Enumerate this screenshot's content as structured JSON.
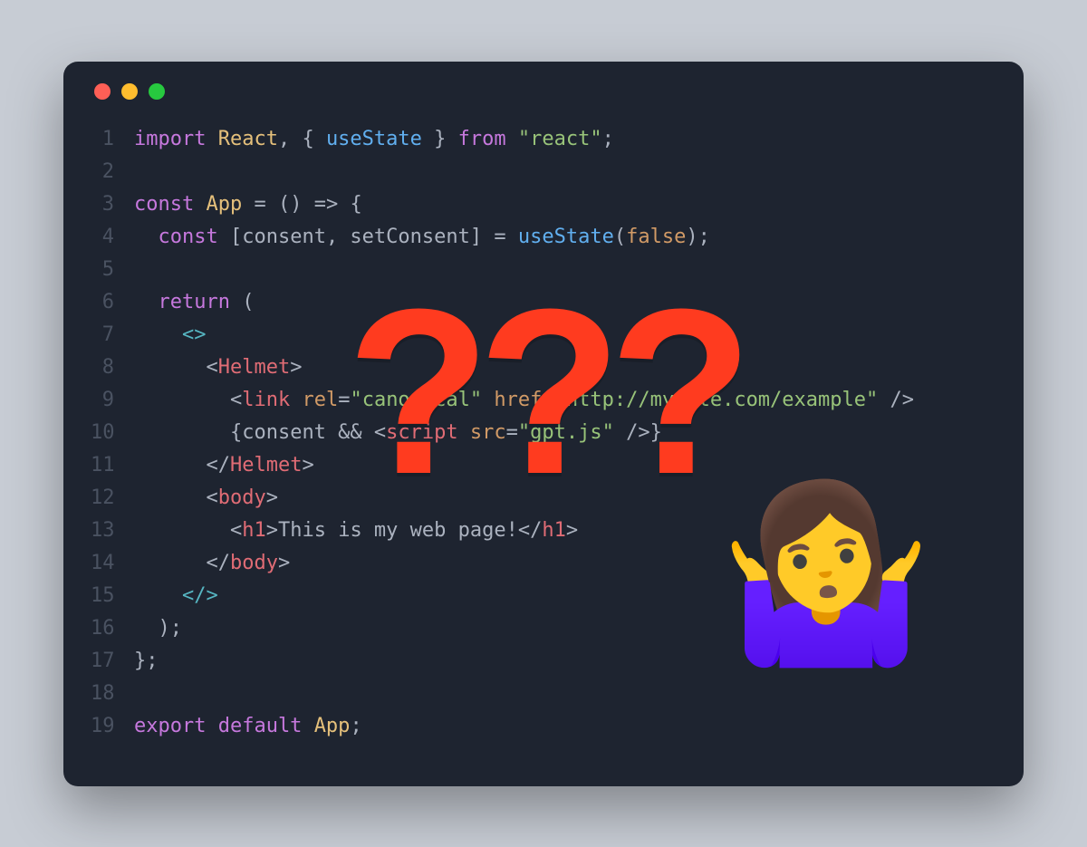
{
  "window": {
    "controls": [
      "close",
      "minimize",
      "zoom"
    ]
  },
  "overlay": {
    "question_marks": "???",
    "shrug_emoji": "🤷‍♀️"
  },
  "code": {
    "lines": [
      {
        "n": "1",
        "tokens": [
          {
            "t": "import ",
            "c": "kw"
          },
          {
            "t": "React",
            "c": "var"
          },
          {
            "t": ", { ",
            "c": "punc"
          },
          {
            "t": "useState",
            "c": "fn"
          },
          {
            "t": " } ",
            "c": "punc"
          },
          {
            "t": "from ",
            "c": "kw"
          },
          {
            "t": "\"react\"",
            "c": "str"
          },
          {
            "t": ";",
            "c": "punc"
          }
        ]
      },
      {
        "n": "2",
        "tokens": []
      },
      {
        "n": "3",
        "tokens": [
          {
            "t": "const ",
            "c": "kw"
          },
          {
            "t": "App",
            "c": "var"
          },
          {
            "t": " = () ",
            "c": "punc"
          },
          {
            "t": "=>",
            "c": "punc"
          },
          {
            "t": " {",
            "c": "punc"
          }
        ]
      },
      {
        "n": "4",
        "tokens": [
          {
            "t": "  ",
            "c": "plain"
          },
          {
            "t": "const ",
            "c": "kw"
          },
          {
            "t": "[consent, setConsent] = ",
            "c": "punc"
          },
          {
            "t": "useState",
            "c": "fn"
          },
          {
            "t": "(",
            "c": "punc"
          },
          {
            "t": "false",
            "c": "bool"
          },
          {
            "t": ");",
            "c": "punc"
          }
        ]
      },
      {
        "n": "5",
        "tokens": []
      },
      {
        "n": "6",
        "tokens": [
          {
            "t": "  ",
            "c": "plain"
          },
          {
            "t": "return ",
            "c": "kw"
          },
          {
            "t": "(",
            "c": "punc"
          }
        ]
      },
      {
        "n": "7",
        "tokens": [
          {
            "t": "    ",
            "c": "plain"
          },
          {
            "t": "<>",
            "c": "brkt"
          }
        ]
      },
      {
        "n": "8",
        "tokens": [
          {
            "t": "      ",
            "c": "plain"
          },
          {
            "t": "<",
            "c": "punc"
          },
          {
            "t": "Helmet",
            "c": "tag"
          },
          {
            "t": ">",
            "c": "punc"
          }
        ]
      },
      {
        "n": "9",
        "tokens": [
          {
            "t": "        ",
            "c": "plain"
          },
          {
            "t": "<",
            "c": "punc"
          },
          {
            "t": "link ",
            "c": "tag"
          },
          {
            "t": "rel",
            "c": "attr"
          },
          {
            "t": "=",
            "c": "punc"
          },
          {
            "t": "\"canonical\"",
            "c": "str"
          },
          {
            "t": " ",
            "c": "plain"
          },
          {
            "t": "href",
            "c": "attr"
          },
          {
            "t": "=",
            "c": "punc"
          },
          {
            "t": "\"http://mysite.com/example\"",
            "c": "str"
          },
          {
            "t": " />",
            "c": "punc"
          }
        ]
      },
      {
        "n": "10",
        "tokens": [
          {
            "t": "        ",
            "c": "plain"
          },
          {
            "t": "{consent && ",
            "c": "punc"
          },
          {
            "t": "<",
            "c": "punc"
          },
          {
            "t": "script ",
            "c": "tag"
          },
          {
            "t": "src",
            "c": "attr"
          },
          {
            "t": "=",
            "c": "punc"
          },
          {
            "t": "\"gpt.js\"",
            "c": "str"
          },
          {
            "t": " />",
            "c": "punc"
          },
          {
            "t": "}",
            "c": "punc"
          }
        ]
      },
      {
        "n": "11",
        "tokens": [
          {
            "t": "      ",
            "c": "plain"
          },
          {
            "t": "</",
            "c": "punc"
          },
          {
            "t": "Helmet",
            "c": "tag"
          },
          {
            "t": ">",
            "c": "punc"
          }
        ]
      },
      {
        "n": "12",
        "tokens": [
          {
            "t": "      ",
            "c": "plain"
          },
          {
            "t": "<",
            "c": "punc"
          },
          {
            "t": "body",
            "c": "tag"
          },
          {
            "t": ">",
            "c": "punc"
          }
        ]
      },
      {
        "n": "13",
        "tokens": [
          {
            "t": "        ",
            "c": "plain"
          },
          {
            "t": "<",
            "c": "punc"
          },
          {
            "t": "h1",
            "c": "tag"
          },
          {
            "t": ">",
            "c": "punc"
          },
          {
            "t": "This is my web page!",
            "c": "plain"
          },
          {
            "t": "</",
            "c": "punc"
          },
          {
            "t": "h1",
            "c": "tag"
          },
          {
            "t": ">",
            "c": "punc"
          }
        ]
      },
      {
        "n": "14",
        "tokens": [
          {
            "t": "      ",
            "c": "plain"
          },
          {
            "t": "</",
            "c": "punc"
          },
          {
            "t": "body",
            "c": "tag"
          },
          {
            "t": ">",
            "c": "punc"
          }
        ]
      },
      {
        "n": "15",
        "tokens": [
          {
            "t": "    ",
            "c": "plain"
          },
          {
            "t": "</>",
            "c": "brkt"
          }
        ]
      },
      {
        "n": "16",
        "tokens": [
          {
            "t": "  );",
            "c": "punc"
          }
        ]
      },
      {
        "n": "17",
        "tokens": [
          {
            "t": "};",
            "c": "punc"
          }
        ]
      },
      {
        "n": "18",
        "tokens": []
      },
      {
        "n": "19",
        "tokens": [
          {
            "t": "export default ",
            "c": "kw"
          },
          {
            "t": "App",
            "c": "var"
          },
          {
            "t": ";",
            "c": "punc"
          }
        ]
      }
    ]
  }
}
